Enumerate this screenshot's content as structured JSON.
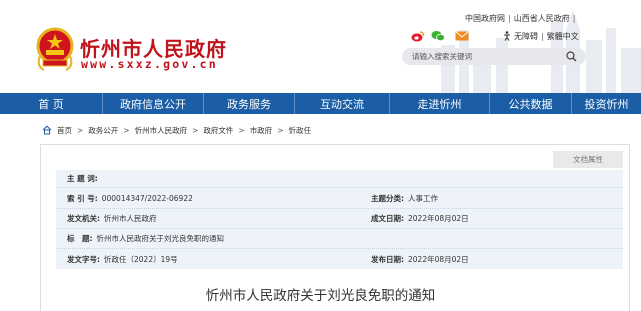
{
  "header": {
    "site_title": "忻州市人民政府",
    "site_url": "www.sxxz.gov.cn",
    "top_links": [
      "中国政府网",
      "山西省人民政府"
    ],
    "accessibility_label": "无障碍",
    "language_label": "繁體中文",
    "search_placeholder": "请输入搜索关键词",
    "social_icons": [
      "weibo-icon",
      "wechat-icon",
      "email-icon"
    ],
    "brand_color": "#c0141c"
  },
  "nav": {
    "color": "#1b5ea6",
    "items": [
      "首 页",
      "政府信息公开",
      "政务服务",
      "互动交流",
      "走进忻州",
      "公共数据",
      "投资忻州"
    ]
  },
  "breadcrumb": [
    "首页",
    "政务公开",
    "忻州市人民政府",
    "政府文件",
    "市政府",
    "忻政任"
  ],
  "document_info": {
    "attributes_tab": "文档属性",
    "subject_label": "主 题 词:",
    "subject_value": "",
    "index_label": "索 引 号:",
    "index_value": "000014347/2022-06922",
    "category_label": "主题分类:",
    "category_value": "人事工作",
    "issuer_label": "发文机关:",
    "issuer_value": "忻州市人民政府",
    "date_label": "成文日期:",
    "date_value": "2022年08月02日",
    "title_label": "标　题:",
    "title_value": "忻州市人民政府关于刘光良免职的通知",
    "doc_number_label": "发文字号:",
    "doc_number_value": "忻政任〔2022〕19号",
    "publish_label": "发布日期:",
    "publish_value": "2022年08月02日"
  },
  "document_title": "忻州市人民政府关于刘光良免职的通知"
}
